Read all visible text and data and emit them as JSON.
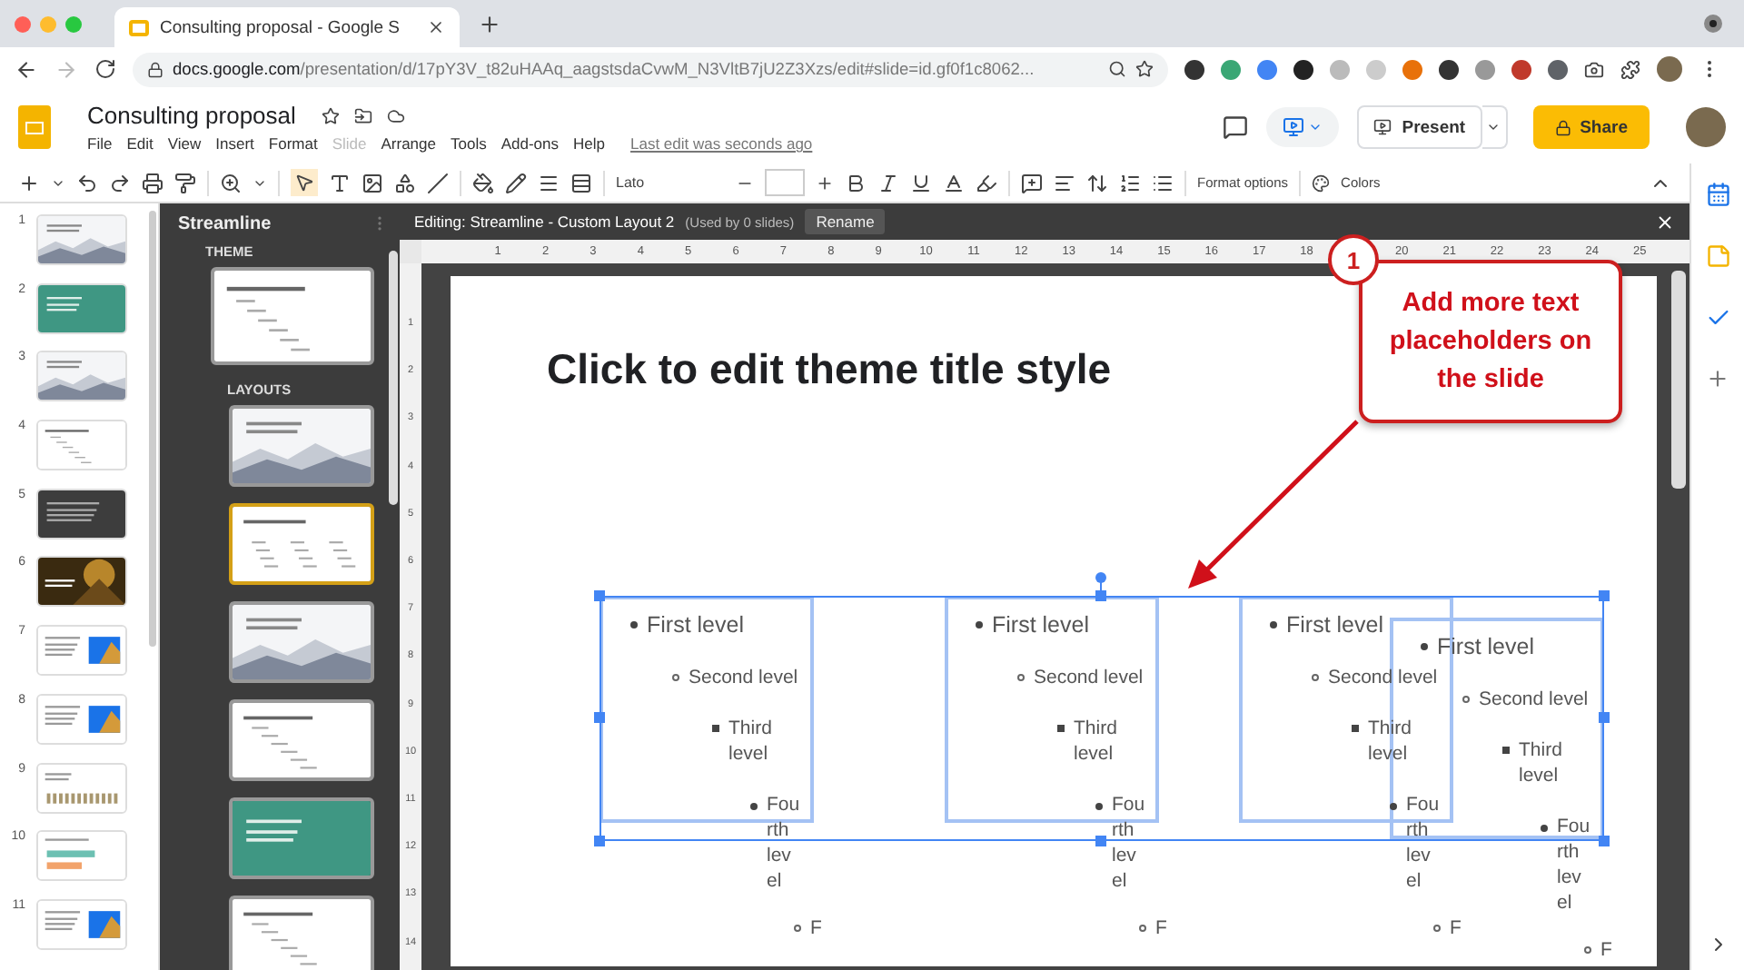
{
  "browser": {
    "tab_title": "Consulting proposal - Google S",
    "url_host": "docs.google.com",
    "url_path": "/presentation/d/17pY3V_t82uHAAq_aagstsdaCvwM_N3VltB7jU2Z3Xzs/edit#slide=id.gf0f1c8062..."
  },
  "doc": {
    "title": "Consulting proposal",
    "menu": [
      {
        "label": "File",
        "disabled": false
      },
      {
        "label": "Edit",
        "disabled": false
      },
      {
        "label": "View",
        "disabled": false
      },
      {
        "label": "Insert",
        "disabled": false
      },
      {
        "label": "Format",
        "disabled": false
      },
      {
        "label": "Slide",
        "disabled": true
      },
      {
        "label": "Arrange",
        "disabled": false
      },
      {
        "label": "Tools",
        "disabled": false
      },
      {
        "label": "Add-ons",
        "disabled": false
      },
      {
        "label": "Help",
        "disabled": false
      }
    ],
    "last_edit": "Last edit was seconds ago",
    "present": "Present",
    "share": "Share"
  },
  "toolbar": {
    "font": "Lato",
    "format_options": "Format options",
    "colors": "Colors"
  },
  "filmstrip": [
    {
      "number": "1",
      "kind": "mountain"
    },
    {
      "number": "2",
      "kind": "teal"
    },
    {
      "number": "3",
      "kind": "mountain"
    },
    {
      "number": "4",
      "kind": "text"
    },
    {
      "number": "5",
      "kind": "dark"
    },
    {
      "number": "6",
      "kind": "photo"
    },
    {
      "number": "7",
      "kind": "split"
    },
    {
      "number": "8",
      "kind": "split"
    },
    {
      "number": "9",
      "kind": "chart"
    },
    {
      "number": "10",
      "kind": "bars"
    },
    {
      "number": "11",
      "kind": "split"
    }
  ],
  "master_panel": {
    "title": "Streamline",
    "theme_label": "THEME",
    "layouts_label": "LAYOUTS",
    "layouts": [
      {
        "kind": "mountain",
        "selected": false
      },
      {
        "kind": "columns",
        "selected": true
      },
      {
        "kind": "mountain",
        "selected": false
      },
      {
        "kind": "text",
        "selected": false
      },
      {
        "kind": "teal",
        "selected": false
      },
      {
        "kind": "text",
        "selected": false
      }
    ]
  },
  "editor": {
    "heading": "Editing: Streamline - Custom Layout 2",
    "usage": "(Used by 0 slides)",
    "rename": "Rename",
    "ruler_h": [
      [
        "1",
        "2",
        "3",
        "4",
        "5",
        "6",
        "7",
        "8",
        "9",
        "10",
        "11",
        "12",
        "13",
        "14",
        "15",
        "16",
        "17",
        "18"
      ],
      [
        "20",
        "21",
        "22",
        "23",
        "24",
        "25"
      ]
    ],
    "ruler_v": [
      "1",
      "2",
      "3",
      "4",
      "5",
      "6",
      "7",
      "8",
      "9",
      "10",
      "11",
      "12",
      "13",
      "14"
    ]
  },
  "slide": {
    "title": "Click to edit theme title style",
    "placeholders": [
      {
        "items": [
          {
            "kind": "disc",
            "text": "First level"
          },
          {
            "kind": "circle",
            "text": "Second level"
          },
          {
            "kind": "square",
            "text": "Third level"
          },
          {
            "kind": "disc",
            "text": "Fourth level"
          },
          {
            "kind": "circle",
            "text": "F"
          }
        ]
      },
      {
        "items": [
          {
            "kind": "disc",
            "text": "First level"
          },
          {
            "kind": "circle",
            "text": "Second level"
          },
          {
            "kind": "square",
            "text": "Third level"
          },
          {
            "kind": "disc",
            "text": "Fourth level"
          },
          {
            "kind": "circle",
            "text": "F"
          }
        ]
      },
      {
        "items": [
          {
            "kind": "disc",
            "text": "First level"
          },
          {
            "kind": "circle",
            "text": "Second level"
          },
          {
            "kind": "square",
            "text": "Third level"
          },
          {
            "kind": "disc",
            "text": "Fourth level"
          },
          {
            "kind": "circle",
            "text": "F"
          }
        ]
      },
      {
        "items": [
          {
            "kind": "disc",
            "text": "First level"
          },
          {
            "kind": "circle",
            "text": "Second level"
          },
          {
            "kind": "square",
            "text": "Third level"
          },
          {
            "kind": "disc",
            "text": "Fourth level"
          },
          {
            "kind": "circle",
            "text": "F"
          }
        ]
      }
    ]
  },
  "callout": {
    "number": "1",
    "text": "Add more text placeholders on the slide"
  }
}
